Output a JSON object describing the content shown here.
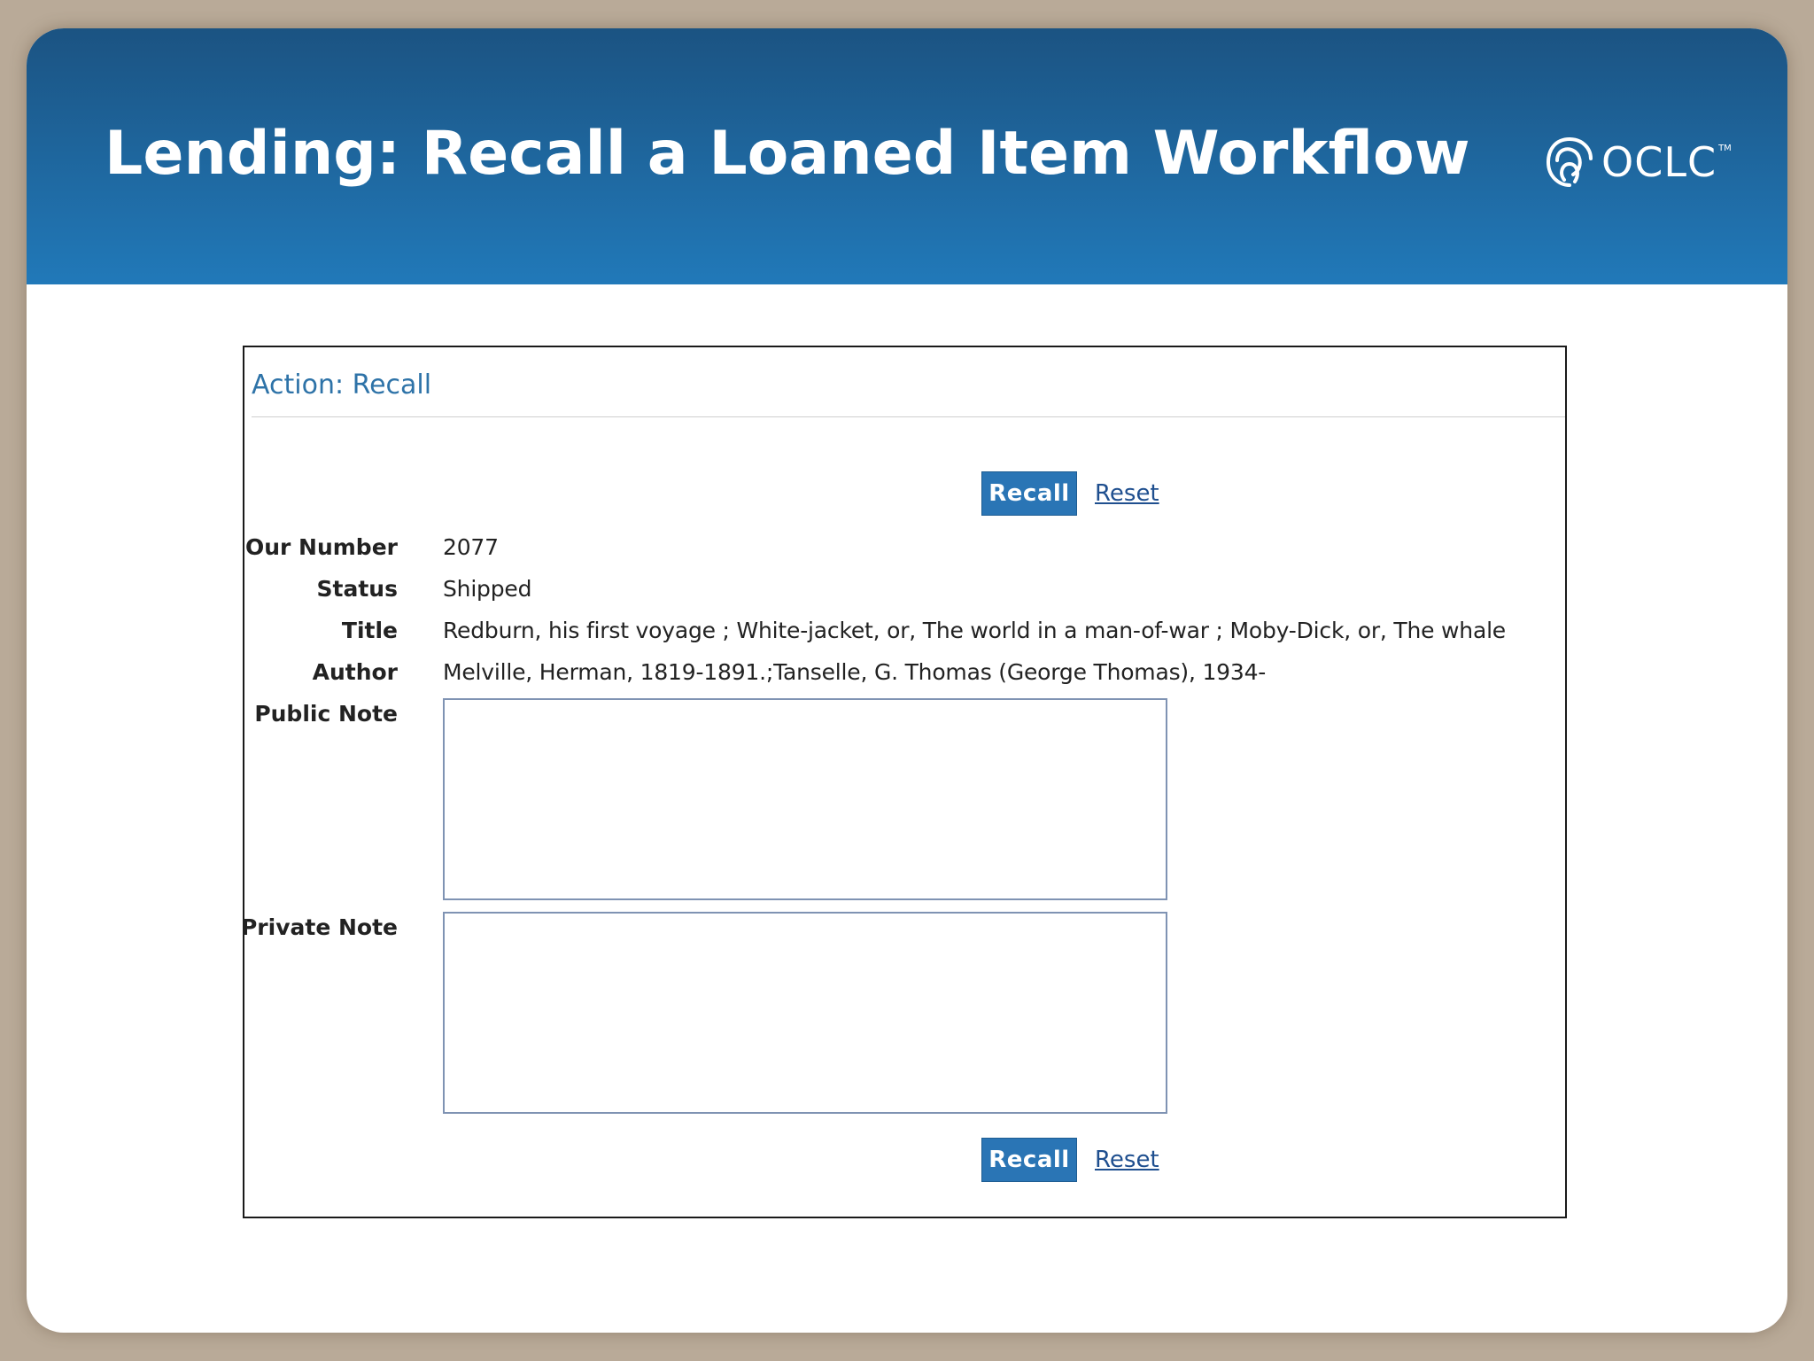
{
  "slide": {
    "title": "Lending: Recall a Loaned Item Workflow",
    "logo_text": "OCLC",
    "logo_tm": "TM"
  },
  "form": {
    "heading": "Action: Recall",
    "recall_label": "Recall",
    "reset_label": "Reset",
    "fields": {
      "our_number": {
        "label": "Our Number",
        "value": "2077"
      },
      "status": {
        "label": "Status",
        "value": "Shipped"
      },
      "title": {
        "label": "Title",
        "value": "Redburn, his first voyage ; White-jacket, or, The world in a man-of-war ; Moby-Dick, or, The whale"
      },
      "author": {
        "label": "Author",
        "value": "Melville, Herman, 1819-1891.;Tanselle, G. Thomas (George Thomas), 1934-"
      },
      "public_note": {
        "label": "Public Note",
        "value": ""
      },
      "private_note": {
        "label": "Private Note",
        "value": ""
      }
    }
  },
  "colors": {
    "banner_top": "#1b5382",
    "banner_bottom": "#2179b9",
    "button": "#2a75b5",
    "heading_text": "#2e73a8"
  }
}
